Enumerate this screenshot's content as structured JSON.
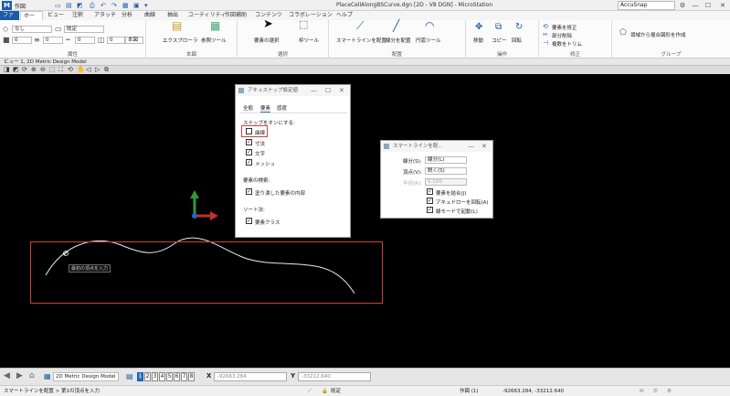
{
  "titlebar": {
    "workspace": "作図",
    "title": "PlaceCellAlongBSCurve.dgn [2D - V8 DGN] - MicroStation",
    "accusnap": "AccuSnap",
    "logo": "M"
  },
  "tabs": [
    "ファイル",
    "ホーム",
    "ビュー",
    "注釈",
    "アタッチ",
    "分析",
    "曲線",
    "抽出",
    "ユーティリティ",
    "作図補助",
    "コンテンツ",
    "コラボレーション",
    "ヘルプ"
  ],
  "ribbon": {
    "attributes": {
      "level": "なし",
      "level_dd": "既定",
      "color": "0",
      "weight": "0",
      "style": "0",
      "extra": "0",
      "name_label": "本図",
      "group_label": "属性"
    },
    "primary": {
      "explorer": "エクスプローラ",
      "ref": "参照ツール",
      "group_label": "本図"
    },
    "selection": {
      "select": "要素の選択",
      "tool": "枠ツール",
      "group_label": "選択"
    },
    "placement": {
      "smartline": "スマートラインを配置",
      "line": "線分を配置",
      "arc": "円弧ツール",
      "group_label": "配置"
    },
    "operation": {
      "move": "移動",
      "copy": "コピー",
      "rotate": "回転",
      "group_label": "操作"
    },
    "modify": {
      "modify": "要素を修正",
      "partial_delete": "部分削除",
      "trim": "複数をトリム",
      "group_label": "修正"
    },
    "group": {
      "create": "領域から複合図形を作成",
      "group_label": "グループ"
    }
  },
  "view": {
    "title": "ビュー 1, 2D Metric Design Model"
  },
  "canvas": {
    "prompt": "最初の頂点を入力"
  },
  "accusnap_dialog": {
    "title": "アキュスナップ設定値",
    "tabs": [
      "全般",
      "要素",
      "感度"
    ],
    "snap_on_label": "スナップをオンにする:",
    "items": [
      {
        "label": "曲線",
        "checked": false
      },
      {
        "label": "寸法",
        "checked": true
      },
      {
        "label": "文字",
        "checked": true
      },
      {
        "label": "メッシュ",
        "checked": true
      }
    ],
    "search_label": "要素の検索:",
    "search_item": {
      "label": "塗り潰した要素の内部",
      "checked": true
    },
    "sort_label": "ソート法:",
    "sort_item": {
      "label": "要素クラス",
      "checked": true
    }
  },
  "smartline_dialog": {
    "title": "スマートラインを配...",
    "segment_label": "線分(S):",
    "segment_value": "線分(L)",
    "vertex_label": "頂点(V):",
    "vertex_value": "鋭く(S)",
    "radius_label": "半径(R):",
    "radius_value": "0.100",
    "options": [
      {
        "label": "要素を結合(J)",
        "checked": true
      },
      {
        "label": "アキュドローを回転(A)",
        "checked": true
      },
      {
        "label": "線モードで起動(L)",
        "checked": true
      }
    ]
  },
  "bottombar": {
    "model": "2D Metric Design Model",
    "view_numbers": [
      "1",
      "2",
      "3",
      "4",
      "5",
      "6",
      "7",
      "8"
    ],
    "active_view": "1",
    "x_label": "X",
    "x_value": "-92663.284",
    "y_label": "Y",
    "y_value": "-33212.640"
  },
  "status": {
    "left": "スマートラインを配置 > 第1の頂点を入力",
    "lock": "既定",
    "workmode": "作図 (1)",
    "coords": "-92663.284, -33212.640"
  }
}
